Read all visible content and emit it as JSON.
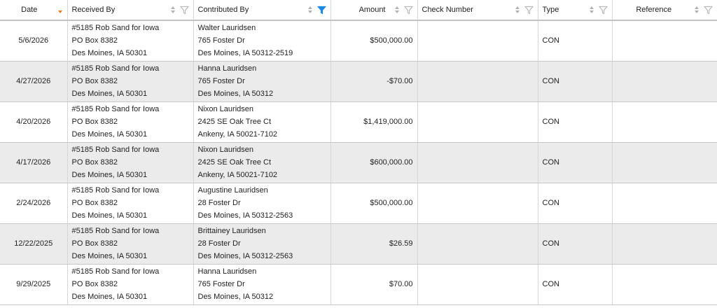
{
  "columns": [
    {
      "key": "date",
      "label": "Date"
    },
    {
      "key": "received_by",
      "label": "Received By"
    },
    {
      "key": "contributed_by",
      "label": "Contributed By"
    },
    {
      "key": "amount",
      "label": "Amount"
    },
    {
      "key": "check_number",
      "label": "Check Number"
    },
    {
      "key": "type",
      "label": "Type"
    },
    {
      "key": "reference",
      "label": "Reference"
    }
  ],
  "colors": {
    "sort_active": "#e07a1f",
    "filter_active": "#1e88e5",
    "icon_inactive": "#b0b0b0",
    "alt_row": "#ebebeb"
  },
  "icons": {
    "sort": "sort-arrows-icon",
    "filter": "funnel-filter-icon"
  },
  "rows": [
    {
      "date": "5/6/2026",
      "received_by": [
        "#5185 Rob Sand for Iowa",
        "PO Box 8382",
        "Des Moines, IA 50301"
      ],
      "contributed_by": [
        "Walter Lauridsen",
        "765 Foster Dr",
        "Des Moines, IA 50312-2519"
      ],
      "amount": "$500,000.00",
      "check_number": "",
      "type": "CON",
      "reference": ""
    },
    {
      "date": "4/27/2026",
      "received_by": [
        "#5185 Rob Sand for Iowa",
        "PO Box 8382",
        "Des Moines, IA 50301"
      ],
      "contributed_by": [
        "Hanna Lauridsen",
        "765 Foster Dr",
        "Des Moines, IA 50312"
      ],
      "amount": "-$70.00",
      "check_number": "",
      "type": "CON",
      "reference": ""
    },
    {
      "date": "4/20/2026",
      "received_by": [
        "#5185 Rob Sand for Iowa",
        "PO Box 8382",
        "Des Moines, IA 50301"
      ],
      "contributed_by": [
        "Nixon Lauridsen",
        "2425 SE Oak Tree Ct",
        "Ankeny, IA 50021-7102"
      ],
      "amount": "$1,419,000.00",
      "check_number": "",
      "type": "CON",
      "reference": ""
    },
    {
      "date": "4/17/2026",
      "received_by": [
        "#5185 Rob Sand for Iowa",
        "PO Box 8382",
        "Des Moines, IA 50301"
      ],
      "contributed_by": [
        "Nixon Lauridsen",
        "2425 SE Oak Tree Ct",
        "Ankeny, IA 50021-7102"
      ],
      "amount": "$600,000.00",
      "check_number": "",
      "type": "CON",
      "reference": ""
    },
    {
      "date": "2/24/2026",
      "received_by": [
        "#5185 Rob Sand for Iowa",
        "PO Box 8382",
        "Des Moines, IA 50301"
      ],
      "contributed_by": [
        "Augustine Lauridsen",
        "28 Foster Dr",
        "Des Moines, IA 50312-2563"
      ],
      "amount": "$500,000.00",
      "check_number": "",
      "type": "CON",
      "reference": ""
    },
    {
      "date": "12/22/2025",
      "received_by": [
        "#5185 Rob Sand for Iowa",
        "PO Box 8382",
        "Des Moines, IA 50301"
      ],
      "contributed_by": [
        "Brittainey Lauridsen",
        "28 Foster Dr",
        "Des Moines, IA 50312-2563"
      ],
      "amount": "$26.59",
      "check_number": "",
      "type": "CON",
      "reference": ""
    },
    {
      "date": "9/29/2025",
      "received_by": [
        "#5185 Rob Sand for Iowa",
        "PO Box 8382",
        "Des Moines, IA 50301"
      ],
      "contributed_by": [
        "Hanna Lauridsen",
        "765 Foster Dr",
        "Des Moines, IA 50312"
      ],
      "amount": "$70.00",
      "check_number": "",
      "type": "CON",
      "reference": ""
    }
  ]
}
